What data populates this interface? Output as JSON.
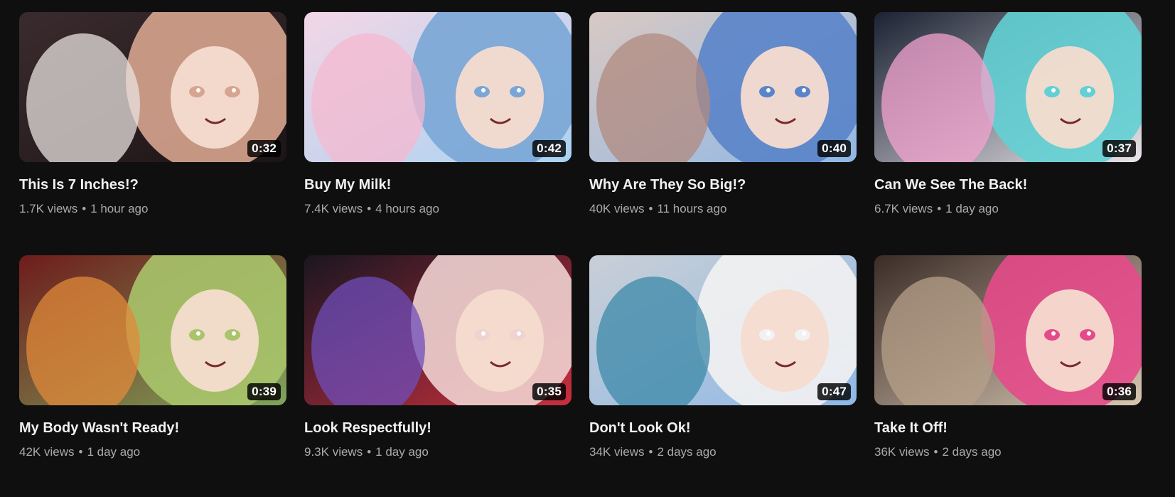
{
  "videos": [
    {
      "title": "This Is 7 Inches!?",
      "views": "1.7K views",
      "age": "1 hour ago",
      "duration": "0:32",
      "palette": [
        "#3a2b2e",
        "#1c1416",
        "#e8e2df",
        "#d7a58f"
      ]
    },
    {
      "title": "Buy My Milk!",
      "views": "7.4K views",
      "age": "4 hours ago",
      "duration": "0:42",
      "palette": [
        "#f2d6e6",
        "#a9d3f2",
        "#f6b8cf",
        "#7aa6d6"
      ]
    },
    {
      "title": "Why Are They So Big!?",
      "views": "40K views",
      "age": "11 hours ago",
      "duration": "0:40",
      "palette": [
        "#d9c9c3",
        "#8fb8e6",
        "#b18a7f",
        "#5a84c9"
      ]
    },
    {
      "title": "Can We See The Back!",
      "views": "6.7K views",
      "age": "1 day ago",
      "duration": "0:37",
      "palette": [
        "#1b2232",
        "#e9e5ea",
        "#f3a3cf",
        "#62d0d4"
      ]
    },
    {
      "title": "My Body Wasn't Ready!",
      "views": "42K views",
      "age": "1 day ago",
      "duration": "0:39",
      "palette": [
        "#6e1c1c",
        "#7fa45a",
        "#e08a3a",
        "#a9c46a"
      ]
    },
    {
      "title": "Look Respectfully!",
      "views": "9.3K views",
      "age": "1 day ago",
      "duration": "0:35",
      "palette": [
        "#1a1620",
        "#c92f3e",
        "#6f4dbb",
        "#f0d2d0"
      ]
    },
    {
      "title": "Don't Look Ok!",
      "views": "34K views",
      "age": "2 days ago",
      "duration": "0:47",
      "palette": [
        "#c9cfd6",
        "#8fb8e6",
        "#3c88a8",
        "#f3f2f2"
      ]
    },
    {
      "title": "Take It Off!",
      "views": "36K views",
      "age": "2 days ago",
      "duration": "0:36",
      "palette": [
        "#3b2c27",
        "#d8c7b3",
        "#b7a08a",
        "#e44b8a"
      ]
    }
  ],
  "separator": "•"
}
